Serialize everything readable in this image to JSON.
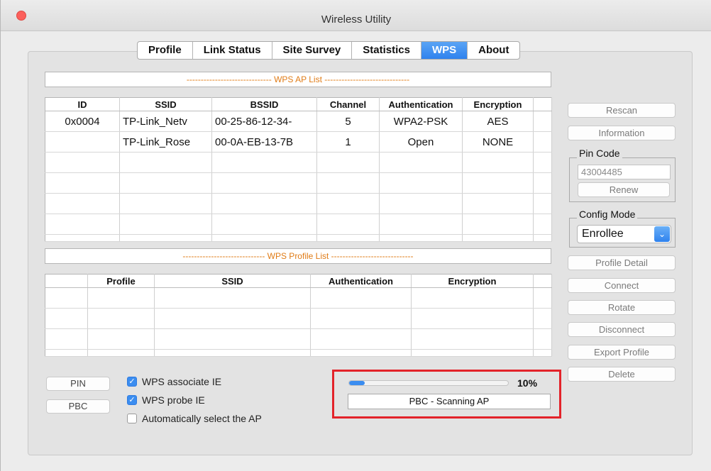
{
  "window": {
    "title": "Wireless Utility"
  },
  "tabs": [
    {
      "label": "Profile"
    },
    {
      "label": "Link Status"
    },
    {
      "label": "Site Survey"
    },
    {
      "label": "Statistics"
    },
    {
      "label": "WPS",
      "active": true
    },
    {
      "label": "About"
    }
  ],
  "ap_list": {
    "title": "------------------------------ WPS AP List ------------------------------",
    "columns": [
      "ID",
      "SSID",
      "BSSID",
      "Channel",
      "Authentication",
      "Encryption"
    ],
    "rows": [
      [
        "0x0004",
        "TP-Link_Netv",
        "00-25-86-12-34-",
        "5",
        "WPA2-PSK",
        "AES"
      ],
      [
        "",
        "TP-Link_Rose",
        "00-0A-EB-13-7B",
        "1",
        "Open",
        "NONE"
      ]
    ]
  },
  "profile_list": {
    "title": "----------------------------- WPS Profile List -----------------------------",
    "columns": [
      "",
      "Profile",
      "SSID",
      "Authentication",
      "Encryption"
    ]
  },
  "side": {
    "rescan": "Rescan",
    "information": "Information",
    "pin_code_label": "Pin Code",
    "pin_code_value": "43004485",
    "renew": "Renew",
    "config_mode_label": "Config Mode",
    "config_mode_value": "Enrollee",
    "profile_detail": "Profile Detail",
    "connect": "Connect",
    "rotate": "Rotate",
    "disconnect": "Disconnect",
    "export_profile": "Export Profile",
    "delete": "Delete"
  },
  "bottom": {
    "pin": "PIN",
    "pbc": "PBC",
    "wps_associate_ie": "WPS associate IE",
    "wps_probe_ie": "WPS probe IE",
    "auto_select_ap": "Automatically select the AP"
  },
  "progress": {
    "percent_label": "10%",
    "percent": 10,
    "status": "PBC - Scanning AP"
  },
  "colors": {
    "accent": "#3b8df0",
    "highlight": "#e3232a",
    "list_title": "#e07c17"
  }
}
